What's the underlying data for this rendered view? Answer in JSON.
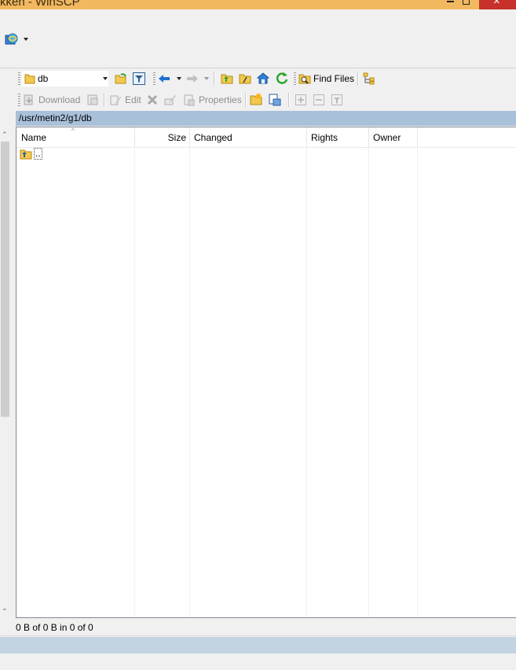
{
  "window": {
    "title": "kken - WinSCP",
    "close_glyph": "×"
  },
  "toolbar": {
    "path_value": "db",
    "find_files_label": "Find Files"
  },
  "actions": {
    "download_label": "Download",
    "edit_label": "Edit",
    "properties_label": "Properties"
  },
  "panel": {
    "path": "/usr/metin2/g1/db",
    "columns": [
      "Name",
      "Size",
      "Changed",
      "Rights",
      "Owner"
    ],
    "rows": [
      {
        "name": ".."
      }
    ]
  },
  "status": {
    "text": "0 B of 0 B in 0 of 0"
  },
  "colors": {
    "titlebar": "#f2b860",
    "close": "#c7302b",
    "pathbar": "#a9c0d9",
    "accent_blue": "#1e6fd0",
    "accent_green": "#2aa52a",
    "folder_yellow": "#f2c94c"
  },
  "icons": {
    "session": "session-globe-icon",
    "folder": "folder-icon",
    "open_dir": "open-directory-icon",
    "filter": "filter-icon",
    "back": "back-arrow-icon",
    "forward": "forward-arrow-icon",
    "parent": "parent-directory-icon",
    "root": "root-directory-icon",
    "home": "home-icon",
    "refresh": "refresh-icon",
    "find": "find-files-icon",
    "tree": "tree-icon",
    "download": "download-icon",
    "edit": "edit-icon",
    "delete": "delete-icon",
    "rename": "rename-icon",
    "properties": "properties-icon",
    "new_folder": "new-folder-icon",
    "plus": "plus-icon",
    "minus": "minus-icon",
    "select": "select-icon"
  }
}
